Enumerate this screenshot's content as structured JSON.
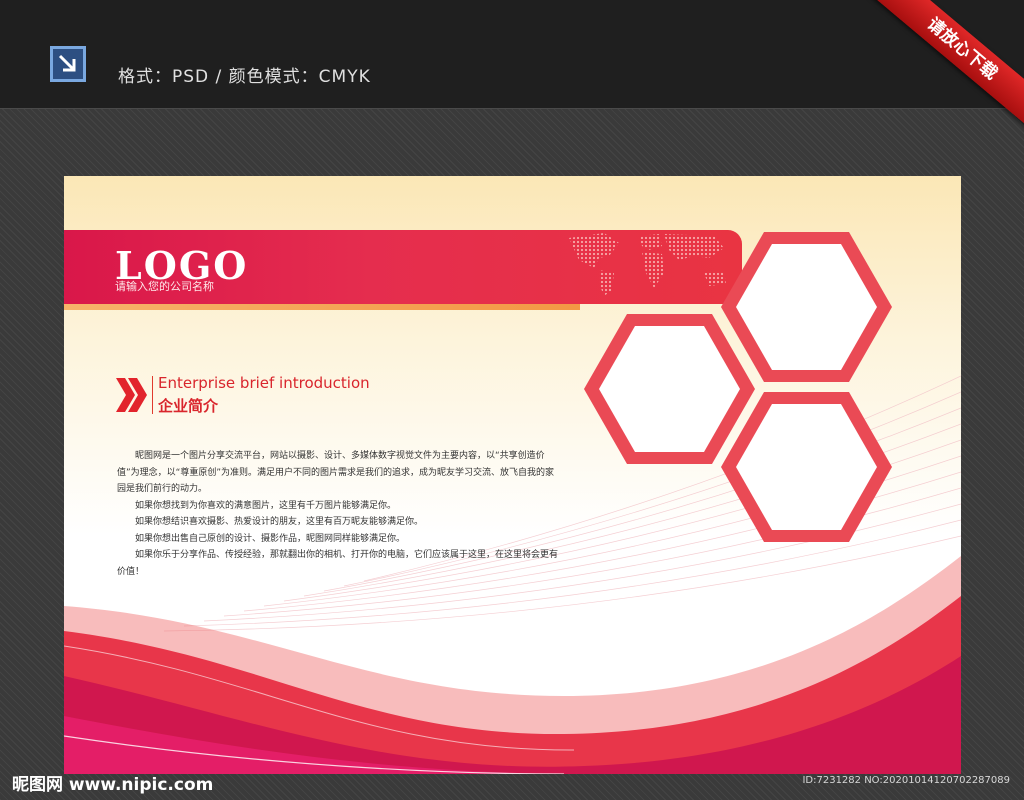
{
  "header": {
    "format_text": "格式：PSD  /  颜色模式：CMYK",
    "format_icon": "arrow-down-right-icon",
    "corner_ribbon": "请放心下载"
  },
  "board": {
    "logo": "LOGO",
    "company_name": "请输入您的公司名称",
    "section_title_en": "Enterprise brief introduction",
    "section_title_cn": "企业简介",
    "intro_paragraphs": [
      "昵图网是一个图片分享交流平台，网站以摄影、设计、多媒体数字视觉文件为主要内容，以“共享创造价值”为理念，以“尊重原创”为准则。满足用户不同的图片需求是我们的追求，成为昵友学习交流、放飞自我的家园是我们前行的动力。",
      "如果你想找到为你喜欢的满意图片，这里有千万图片能够满足你。",
      "如果你想结识喜欢摄影、热爱设计的朋友，这里有百万昵友能够满足你。",
      "如果你想出售自己原创的设计、摄影作品，昵图网同样能够满足你。",
      "如果你乐于分享作品、传授经验，那就翻出你的相机、打开你的电脑，它们应该属于这里，在这里将会更有价值！"
    ]
  },
  "footer": {
    "site_watermark": "昵图网 www.nipic.com",
    "id_text": "ID:7231282 NO:20201014120702287089"
  },
  "colors": {
    "accent_red": "#e23a2e",
    "banner_pink": "#d9174a",
    "topbar": "#1f1f1f"
  }
}
